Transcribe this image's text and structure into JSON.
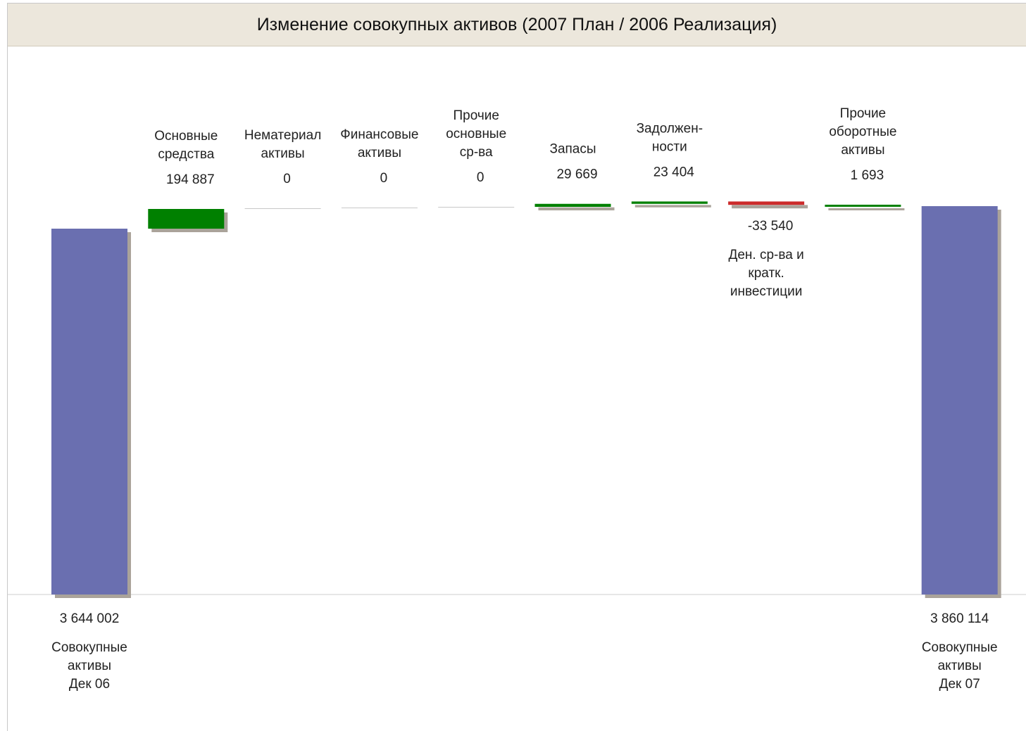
{
  "title": "Изменение совокупных активов (2007 План / 2006 Реализация)",
  "colors": {
    "total": "#6a6fb0",
    "increase": "#008000",
    "decrease": "#cc2b2b",
    "zero": "#c8c8c8",
    "shadow": "#aaa39a",
    "title_bg": "#ece7dc"
  },
  "chart_data": {
    "type": "waterfall",
    "title": "Изменение совокупных активов (2007 План / 2006 Реализация)",
    "xlabel": "",
    "ylabel": "",
    "steps": [
      {
        "kind": "total",
        "label_lines": [
          "Совокупные",
          "активы",
          "Дек 06"
        ],
        "value_text": "3 644 002",
        "value": 3644002
      },
      {
        "kind": "delta",
        "label_lines": [
          "Основные",
          "средства"
        ],
        "value_text": "194 887",
        "value": 194887
      },
      {
        "kind": "delta",
        "label_lines": [
          "Нематериал",
          "активы"
        ],
        "value_text": "0",
        "value": 0
      },
      {
        "kind": "delta",
        "label_lines": [
          "Финансовые",
          "активы"
        ],
        "value_text": "0",
        "value": 0
      },
      {
        "kind": "delta",
        "label_lines": [
          "Прочие",
          "основные",
          "ср-ва"
        ],
        "value_text": "0",
        "value": 0
      },
      {
        "kind": "delta",
        "label_lines": [
          "Запасы"
        ],
        "value_text": "29 669",
        "value": 29669
      },
      {
        "kind": "delta",
        "label_lines": [
          "Задолжен-",
          "ности"
        ],
        "value_text": "23 404",
        "value": 23404
      },
      {
        "kind": "delta",
        "label_lines": [
          "Ден. ср-ва и",
          "кратк.",
          "инвестиции"
        ],
        "value_text": "-33 540",
        "value": -33540
      },
      {
        "kind": "delta",
        "label_lines": [
          "Прочие",
          "оборотные",
          "активы"
        ],
        "value_text": "1 693",
        "value": 1693
      },
      {
        "kind": "total",
        "label_lines": [
          "Совокупные",
          "активы",
          "Дек 07"
        ],
        "value_text": "3 860 114",
        "value": 3860114
      }
    ]
  }
}
